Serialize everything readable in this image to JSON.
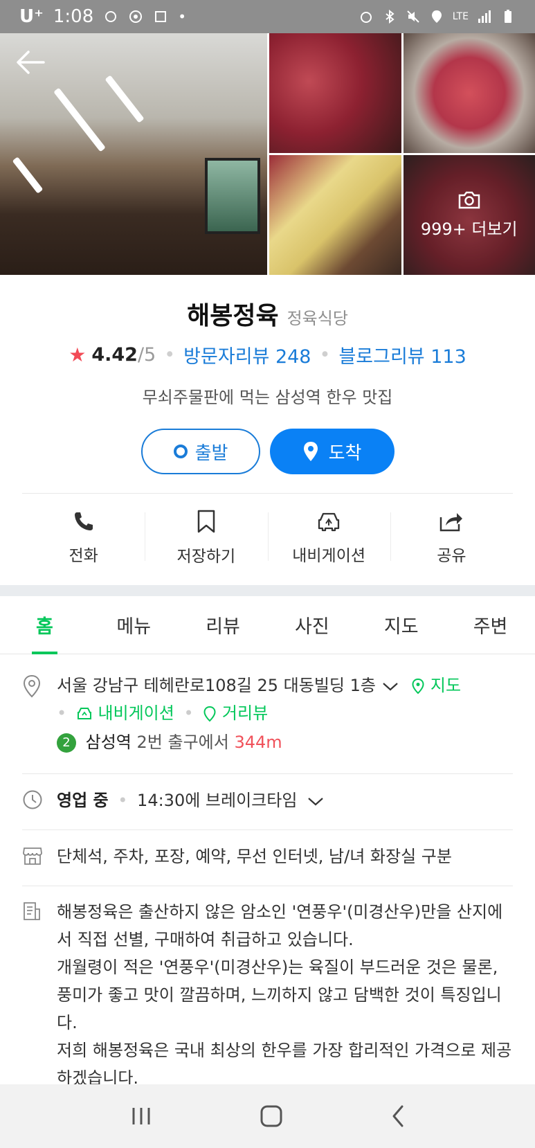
{
  "status_bar": {
    "carrier": "U⁺",
    "time": "1:08",
    "network": "LTE"
  },
  "photos": {
    "more_label": "999+ 더보기"
  },
  "place": {
    "name": "해봉정육",
    "category": "정육식당",
    "rating": "4.42",
    "rating_max": "/5",
    "visitor_reviews": "방문자리뷰 248",
    "blog_reviews": "블로그리뷰 113",
    "description": "무쇠주물판에 먹는 삼성역 한우 맛집"
  },
  "route": {
    "start_label": "출발",
    "arrive_label": "도착"
  },
  "actions": [
    {
      "label": "전화",
      "icon": "phone-icon"
    },
    {
      "label": "저장하기",
      "icon": "bookmark-icon"
    },
    {
      "label": "내비게이션",
      "icon": "car-navigation-icon"
    },
    {
      "label": "공유",
      "icon": "share-icon"
    }
  ],
  "tabs": [
    {
      "label": "홈",
      "active": true
    },
    {
      "label": "메뉴"
    },
    {
      "label": "리뷰"
    },
    {
      "label": "사진"
    },
    {
      "label": "지도"
    },
    {
      "label": "주변"
    }
  ],
  "info": {
    "address": "서울 강남구 테헤란로108길 25 대동빌딩 1층",
    "map_link": "지도",
    "navi_link": "내비게이션",
    "street_view_link": "거리뷰",
    "subway_line": "2",
    "station": "삼성역",
    "exit_text": "2번 출구에서",
    "distance": "344m",
    "status": "영업 중",
    "break_time": "14:30에 브레이크타임",
    "amenities": "단체석, 주차, 포장, 예약, 무선 인터넷, 남/녀 화장실 구분",
    "intro_1": "해봉정육은 출산하지 않은 암소인 '연풍우'(미경산우)만을 산지에서 직접 선별, 구매하여 취급하고 있습니다.",
    "intro_2": "개월령이 적은 '연풍우'(미경산우)는 육질이 부드러운 것은 물론, 풍미가 좋고 맛이 깔끔하며, 느끼하지 않고 담백한 것이 특징입니다.",
    "intro_3": "저희 해봉정육은 국내 최상의 한우를 가장 합리적인 가격으로 제공하겠습니다."
  },
  "colors": {
    "accent_blue": "#0a81f5",
    "link_blue": "#1a7cd8",
    "naver_green": "#03c75a",
    "star_red": "#f24b56",
    "distance_red": "#f0515a"
  }
}
